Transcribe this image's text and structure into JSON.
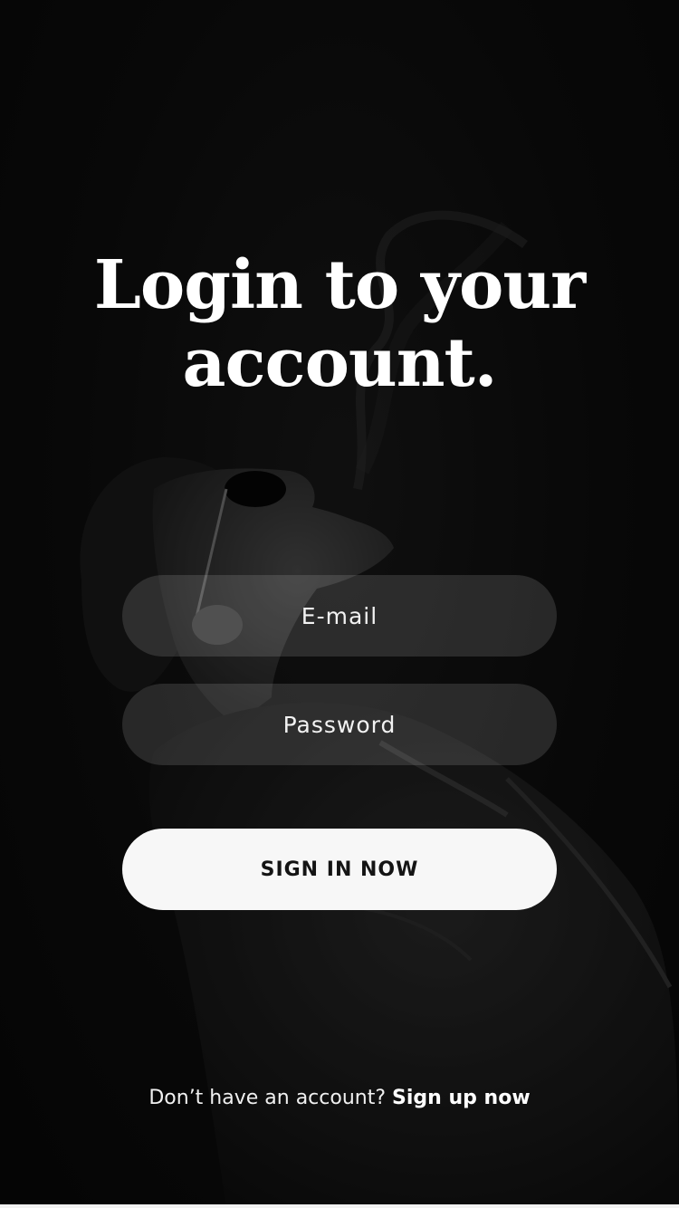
{
  "screen": {
    "background_color": "#0e0e0e",
    "accent_button_color": "#f7f7f7"
  },
  "header": {
    "title_line1": "Login to your",
    "title_line2": "account."
  },
  "form": {
    "email_placeholder": "E-mail",
    "password_placeholder": "Password",
    "submit_label": "SIGN IN NOW"
  },
  "footer": {
    "prompt_text": "Don’t have an account?",
    "signup_label": "Sign up now"
  }
}
